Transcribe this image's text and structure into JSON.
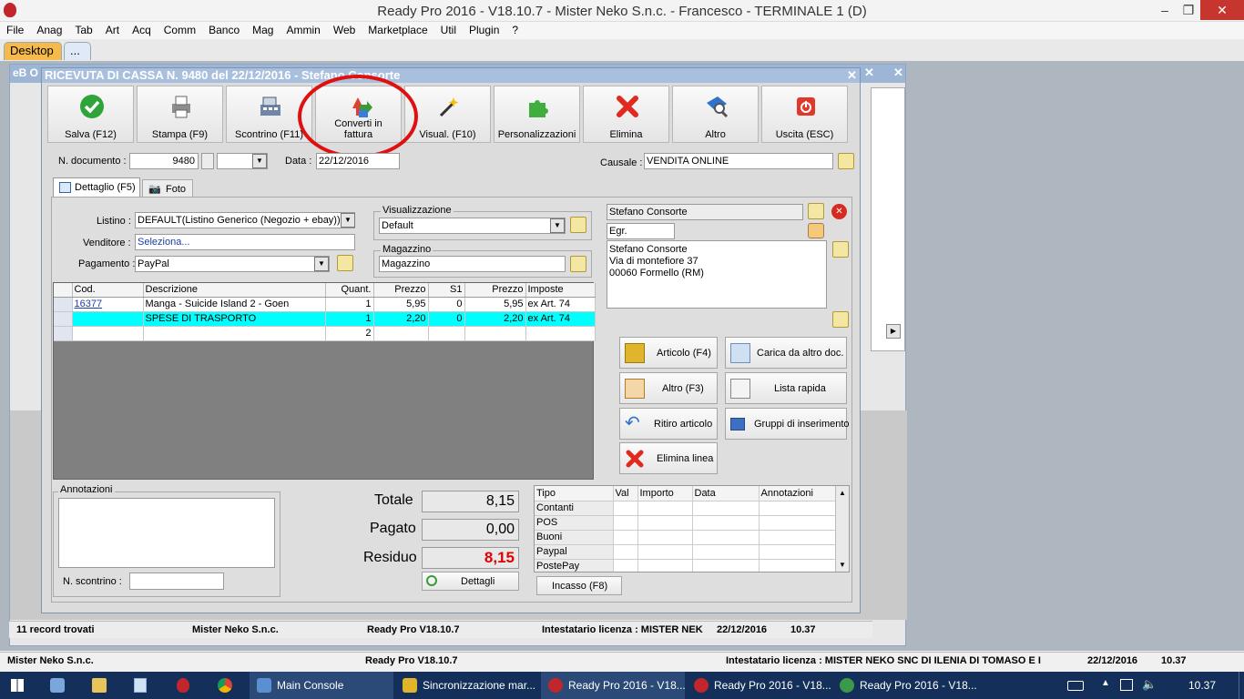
{
  "app": {
    "title": "Ready Pro 2016 - V18.10.7 - Mister Neko S.n.c. - Francesco - TERMINALE 1 (D)"
  },
  "menu": [
    "File",
    "Anag",
    "Tab",
    "Art",
    "Acq",
    "Comm",
    "Banco",
    "Mag",
    "Ammin",
    "Web",
    "Marketplace",
    "Util",
    "Plugin",
    "?"
  ],
  "tabs": {
    "desktop": "Desktop",
    "more": "..."
  },
  "bg": {
    "title": "eB O"
  },
  "dialog": {
    "title": "RICEVUTA DI CASSA N. 9480 del 22/12/2016 - Stefano Consorte"
  },
  "toolbar": [
    {
      "label": "Salva (F12)",
      "icon": "check-icon"
    },
    {
      "label": "Stampa (F9)",
      "icon": "printer-icon"
    },
    {
      "label": "Scontrino (F11)",
      "icon": "register-icon"
    },
    {
      "label": "Converti in fattura",
      "icon": "convert-icon"
    },
    {
      "label": "Visual. (F10)",
      "icon": "magic-wand-icon"
    },
    {
      "label": "Personalizzazioni",
      "icon": "puzzle-icon"
    },
    {
      "label": "Elimina",
      "icon": "delete-icon"
    },
    {
      "label": "Altro",
      "icon": "magnifier-icon"
    },
    {
      "label": "Uscita (ESC)",
      "icon": "exit-icon"
    }
  ],
  "doc": {
    "number_label": "N. documento :",
    "number": "9480",
    "date_label": "Data :",
    "date": "22/12/2016",
    "causale_label": "Causale :",
    "causale": "VENDITA ONLINE"
  },
  "detail_tabs": {
    "dettaglio": "Dettaglio (F5)",
    "foto": "Foto"
  },
  "form": {
    "listino_label": "Listino :",
    "listino": "DEFAULT(Listino Generico (Negozio + ebay))",
    "venditore_label": "Venditore :",
    "venditore": "Seleziona...",
    "pagamento_label": "Pagamento :",
    "pagamento": "PayPal",
    "visualizzazione_label": "Visualizzazione",
    "visualizzazione": "Default",
    "magazzino_label": "Magazzino",
    "magazzino": "Magazzino"
  },
  "customer": {
    "name": "Stefano Consorte",
    "title": "Egr.",
    "address_line1": "Stefano Consorte",
    "address_line2": "Via di montefiore 37",
    "address_line3": "00060 Formello (RM)"
  },
  "grid": {
    "columns": [
      "Cod.",
      "Descrizione",
      "Quant.",
      "Prezzo",
      "S1",
      "Prezzo",
      "Imposte"
    ],
    "rows": [
      [
        "16377",
        "Manga - Suicide Island 2 - Goen",
        "1",
        "5,95",
        "0",
        "5,95",
        "ex Art. 74"
      ],
      [
        "",
        "SPESE DI TRASPORTO",
        "1",
        "2,20",
        "0",
        "2,20",
        "ex Art. 74"
      ],
      [
        "",
        "",
        "2",
        "",
        "",
        "",
        ""
      ]
    ]
  },
  "side_buttons": {
    "articolo": "Articolo (F4)",
    "carica": "Carica da altro doc.",
    "altro": "Altro (F3)",
    "lista": "Lista rapida",
    "ritiro": "Ritiro articolo",
    "gruppi": "Gruppi di inserimento",
    "elimina": "Elimina linea"
  },
  "annotazioni": {
    "label": "Annotazioni",
    "scontrino_label": "N. scontrino :"
  },
  "totals": {
    "totale_label": "Totale",
    "totale": "8,15",
    "pagato_label": "Pagato",
    "pagato": "0,00",
    "residuo_label": "Residuo",
    "residuo": "8,15",
    "dettagli": "Dettagli"
  },
  "payments": {
    "columns": [
      "Tipo",
      "Val",
      "Importo",
      "Data",
      "Annotazioni"
    ],
    "rows": [
      "Contanti",
      "POS",
      "Buoni",
      "Paypal",
      "PostePay"
    ],
    "incasso": "Incasso (F8)"
  },
  "status_inner": {
    "records": "11 record trovati",
    "company": "Mister Neko S.n.c.",
    "version": "Ready Pro V18.10.7",
    "license": "Intestatario licenza : MISTER NEK",
    "date": "22/12/2016",
    "time": "10.37"
  },
  "status_main": {
    "company": "Mister Neko S.n.c.",
    "version": "Ready Pro V18.10.7",
    "license": "Intestatario licenza : MISTER NEKO SNC DI ILENIA DI TOMASO E I",
    "date": "22/12/2016",
    "time": "10.37"
  },
  "taskbar": {
    "items": [
      "Main Console",
      "Sincronizzazione mar...",
      "Ready Pro 2016 - V18...",
      "Ready Pro 2016 - V18...",
      "Ready Pro 2016 - V18..."
    ],
    "clock": "10.37"
  },
  "colors": {
    "highlight_row": "#00ffff",
    "residuo": "#e00000",
    "annotation_circle": "#e01010"
  }
}
